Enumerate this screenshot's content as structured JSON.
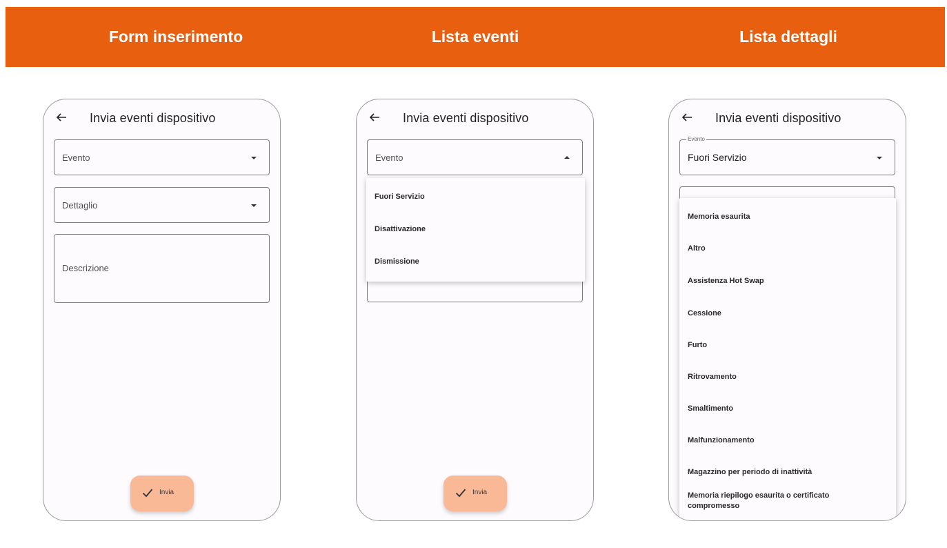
{
  "colors": {
    "accent": "#e8600f",
    "fab": "#f9b896"
  },
  "banner": {
    "titles": [
      "Form inserimento",
      "Lista eventi",
      "Lista dettagli"
    ]
  },
  "icons": {
    "back": "arrow-left-icon",
    "check": "check-icon",
    "dropdown": "caret-down-icon",
    "dropup": "caret-up-icon"
  },
  "screen1": {
    "title": "Invia eventi dispositivo",
    "evento_placeholder": "Evento",
    "dettaglio_placeholder": "Dettaglio",
    "descrizione_placeholder": "Descrizione",
    "submit_label": "Invia"
  },
  "screen2": {
    "title": "Invia eventi dispositivo",
    "evento_placeholder": "Evento",
    "options": [
      "Fuori Servizio",
      "Disattivazione",
      "Dismissione"
    ],
    "submit_label": "Invia"
  },
  "screen3": {
    "title": "Invia eventi dispositivo",
    "evento_label": "Evento",
    "evento_value": "Fuori Servizio",
    "options": [
      "Memoria esaurita",
      "Altro",
      "Assistenza Hot Swap",
      "Cessione",
      "Furto",
      "Ritrovamento",
      "Smaltimento",
      "Malfunzionamento",
      "Magazzino per periodo di inattività",
      "Memoria riepilogo esaurita o certificato compromesso"
    ]
  }
}
